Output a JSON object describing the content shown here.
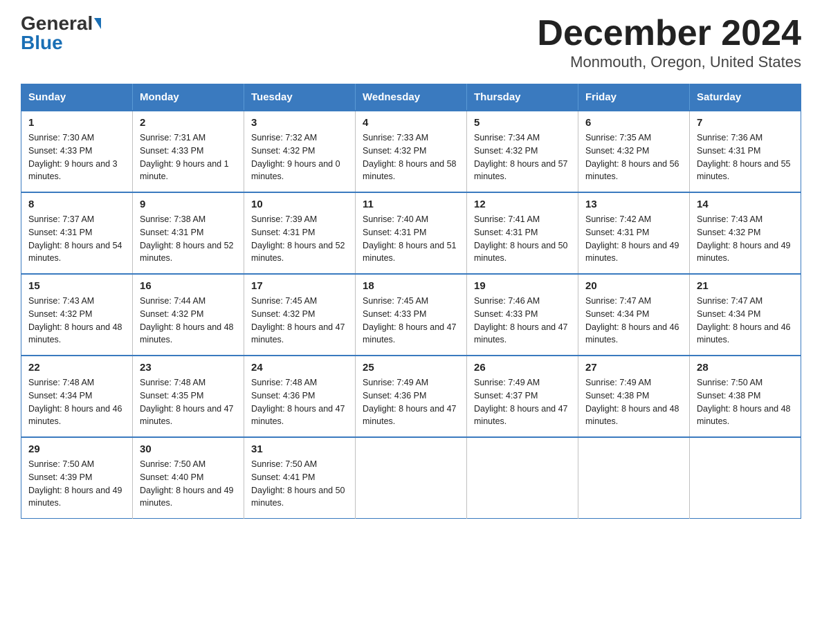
{
  "logo": {
    "general": "General",
    "blue": "Blue"
  },
  "title": "December 2024",
  "subtitle": "Monmouth, Oregon, United States",
  "header": {
    "days": [
      "Sunday",
      "Monday",
      "Tuesday",
      "Wednesday",
      "Thursday",
      "Friday",
      "Saturday"
    ]
  },
  "weeks": [
    [
      {
        "day": "1",
        "sunrise": "7:30 AM",
        "sunset": "4:33 PM",
        "daylight": "9 hours and 3 minutes."
      },
      {
        "day": "2",
        "sunrise": "7:31 AM",
        "sunset": "4:33 PM",
        "daylight": "9 hours and 1 minute."
      },
      {
        "day": "3",
        "sunrise": "7:32 AM",
        "sunset": "4:32 PM",
        "daylight": "9 hours and 0 minutes."
      },
      {
        "day": "4",
        "sunrise": "7:33 AM",
        "sunset": "4:32 PM",
        "daylight": "8 hours and 58 minutes."
      },
      {
        "day": "5",
        "sunrise": "7:34 AM",
        "sunset": "4:32 PM",
        "daylight": "8 hours and 57 minutes."
      },
      {
        "day": "6",
        "sunrise": "7:35 AM",
        "sunset": "4:32 PM",
        "daylight": "8 hours and 56 minutes."
      },
      {
        "day": "7",
        "sunrise": "7:36 AM",
        "sunset": "4:31 PM",
        "daylight": "8 hours and 55 minutes."
      }
    ],
    [
      {
        "day": "8",
        "sunrise": "7:37 AM",
        "sunset": "4:31 PM",
        "daylight": "8 hours and 54 minutes."
      },
      {
        "day": "9",
        "sunrise": "7:38 AM",
        "sunset": "4:31 PM",
        "daylight": "8 hours and 52 minutes."
      },
      {
        "day": "10",
        "sunrise": "7:39 AM",
        "sunset": "4:31 PM",
        "daylight": "8 hours and 52 minutes."
      },
      {
        "day": "11",
        "sunrise": "7:40 AM",
        "sunset": "4:31 PM",
        "daylight": "8 hours and 51 minutes."
      },
      {
        "day": "12",
        "sunrise": "7:41 AM",
        "sunset": "4:31 PM",
        "daylight": "8 hours and 50 minutes."
      },
      {
        "day": "13",
        "sunrise": "7:42 AM",
        "sunset": "4:31 PM",
        "daylight": "8 hours and 49 minutes."
      },
      {
        "day": "14",
        "sunrise": "7:43 AM",
        "sunset": "4:32 PM",
        "daylight": "8 hours and 49 minutes."
      }
    ],
    [
      {
        "day": "15",
        "sunrise": "7:43 AM",
        "sunset": "4:32 PM",
        "daylight": "8 hours and 48 minutes."
      },
      {
        "day": "16",
        "sunrise": "7:44 AM",
        "sunset": "4:32 PM",
        "daylight": "8 hours and 48 minutes."
      },
      {
        "day": "17",
        "sunrise": "7:45 AM",
        "sunset": "4:32 PM",
        "daylight": "8 hours and 47 minutes."
      },
      {
        "day": "18",
        "sunrise": "7:45 AM",
        "sunset": "4:33 PM",
        "daylight": "8 hours and 47 minutes."
      },
      {
        "day": "19",
        "sunrise": "7:46 AM",
        "sunset": "4:33 PM",
        "daylight": "8 hours and 47 minutes."
      },
      {
        "day": "20",
        "sunrise": "7:47 AM",
        "sunset": "4:34 PM",
        "daylight": "8 hours and 46 minutes."
      },
      {
        "day": "21",
        "sunrise": "7:47 AM",
        "sunset": "4:34 PM",
        "daylight": "8 hours and 46 minutes."
      }
    ],
    [
      {
        "day": "22",
        "sunrise": "7:48 AM",
        "sunset": "4:34 PM",
        "daylight": "8 hours and 46 minutes."
      },
      {
        "day": "23",
        "sunrise": "7:48 AM",
        "sunset": "4:35 PM",
        "daylight": "8 hours and 47 minutes."
      },
      {
        "day": "24",
        "sunrise": "7:48 AM",
        "sunset": "4:36 PM",
        "daylight": "8 hours and 47 minutes."
      },
      {
        "day": "25",
        "sunrise": "7:49 AM",
        "sunset": "4:36 PM",
        "daylight": "8 hours and 47 minutes."
      },
      {
        "day": "26",
        "sunrise": "7:49 AM",
        "sunset": "4:37 PM",
        "daylight": "8 hours and 47 minutes."
      },
      {
        "day": "27",
        "sunrise": "7:49 AM",
        "sunset": "4:38 PM",
        "daylight": "8 hours and 48 minutes."
      },
      {
        "day": "28",
        "sunrise": "7:50 AM",
        "sunset": "4:38 PM",
        "daylight": "8 hours and 48 minutes."
      }
    ],
    [
      {
        "day": "29",
        "sunrise": "7:50 AM",
        "sunset": "4:39 PM",
        "daylight": "8 hours and 49 minutes."
      },
      {
        "day": "30",
        "sunrise": "7:50 AM",
        "sunset": "4:40 PM",
        "daylight": "8 hours and 49 minutes."
      },
      {
        "day": "31",
        "sunrise": "7:50 AM",
        "sunset": "4:41 PM",
        "daylight": "8 hours and 50 minutes."
      },
      null,
      null,
      null,
      null
    ]
  ],
  "labels": {
    "sunrise": "Sunrise:",
    "sunset": "Sunset:",
    "daylight": "Daylight:"
  }
}
